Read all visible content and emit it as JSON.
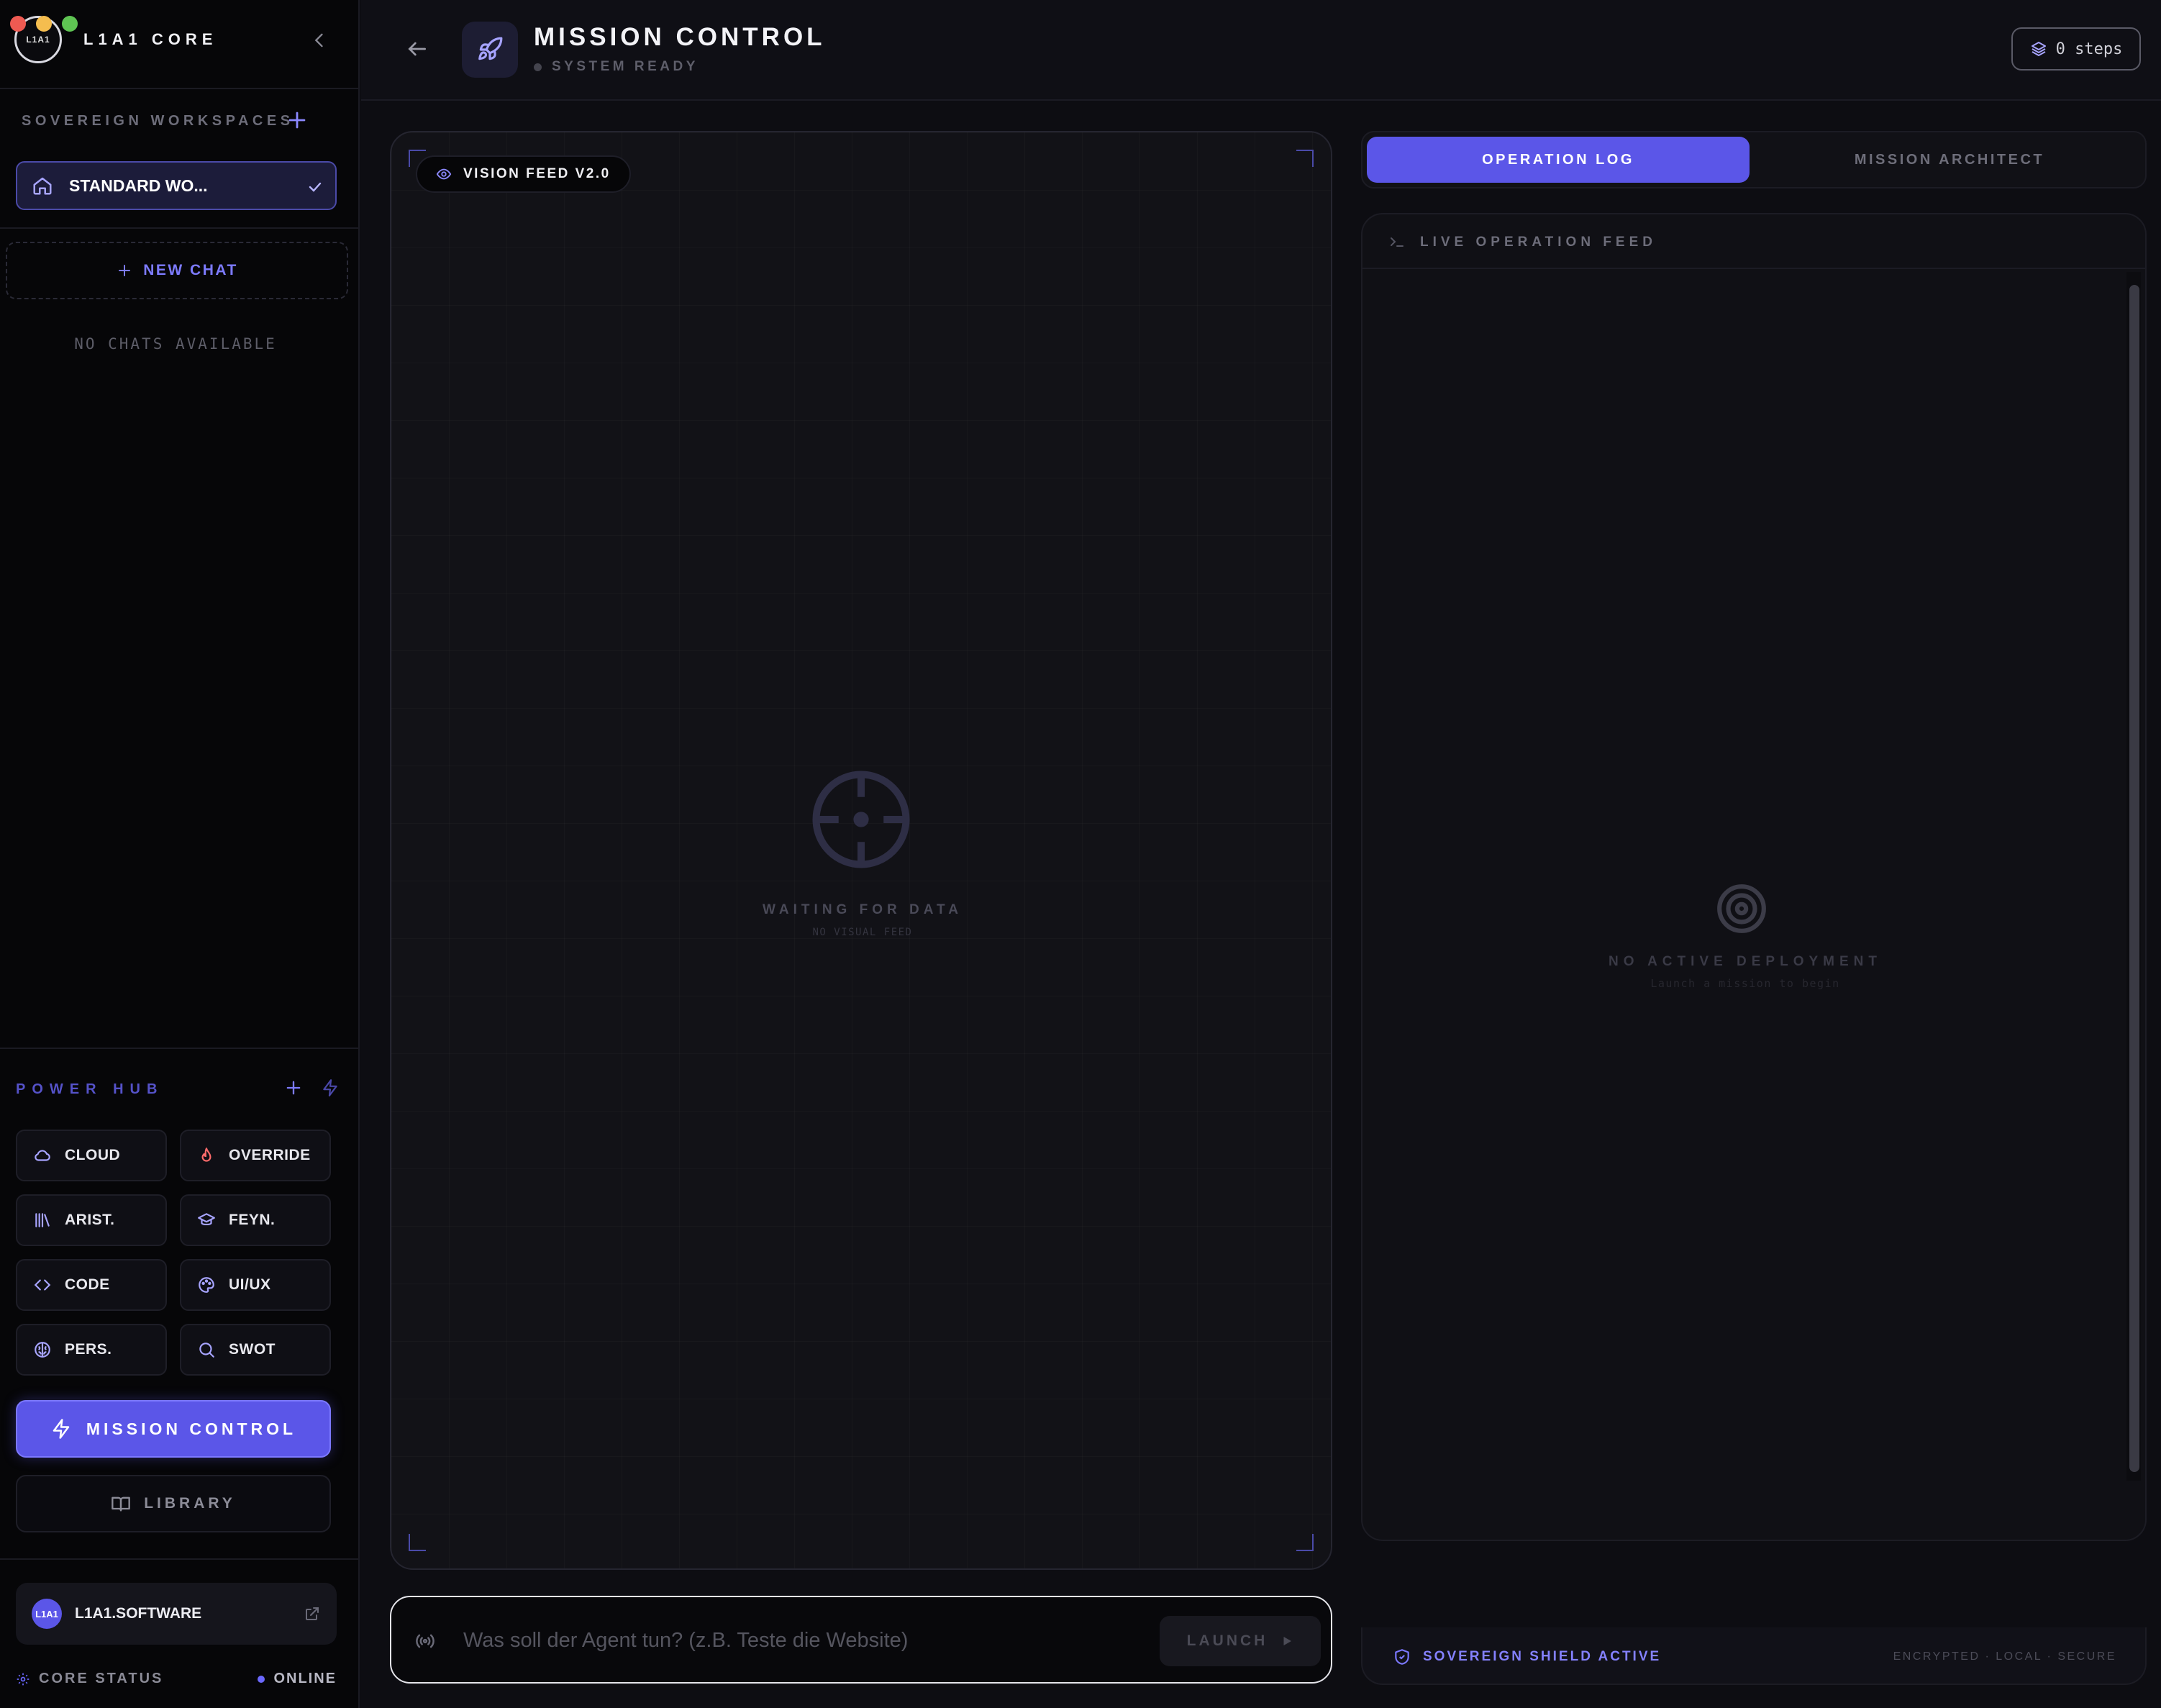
{
  "window": {
    "title": "L1A1 CORE"
  },
  "brand": {
    "logo_text": "L1A1",
    "name": "L1A1 CORE"
  },
  "workspaces": {
    "title": "SOVEREIGN WORKSPACES",
    "active": "STANDARD WO..."
  },
  "chats": {
    "new_label": "NEW CHAT",
    "empty_label": "NO CHATS AVAILABLE"
  },
  "power_hub": {
    "title": "POWER HUB",
    "items": [
      {
        "label": "CLOUD",
        "icon": "cloud-icon",
        "color": "#a7a4ff"
      },
      {
        "label": "OVERRIDE",
        "icon": "flame-icon",
        "color": "#ff6b6b"
      },
      {
        "label": "ARIST.",
        "icon": "library-icon",
        "color": "#a7a4ff"
      },
      {
        "label": "FEYN.",
        "icon": "graduation-cap-icon",
        "color": "#a7a4ff"
      },
      {
        "label": "CODE",
        "icon": "code-icon",
        "color": "#a7a4ff"
      },
      {
        "label": "UI/UX",
        "icon": "palette-icon",
        "color": "#a7a4ff"
      },
      {
        "label": "PERS.",
        "icon": "brain-icon",
        "color": "#a7a4ff"
      },
      {
        "label": "SWOT",
        "icon": "search-icon",
        "color": "#a7a4ff"
      }
    ],
    "mission_control": "MISSION CONTROL",
    "library": "LIBRARY"
  },
  "account": {
    "avatar_text": "L1A1",
    "name": "L1A1.SOFTWARE"
  },
  "status": {
    "label": "CORE STATUS",
    "value": "ONLINE"
  },
  "header": {
    "title": "MISSION CONTROL",
    "status": "SYSTEM READY",
    "steps": "0 steps"
  },
  "vision": {
    "badge": "VISION FEED V2.0",
    "waiting": "WAITING FOR DATA",
    "sub": "NO VISUAL FEED"
  },
  "command": {
    "placeholder": "Was soll der Agent tun? (z.B. Teste die Website)",
    "launch": "LAUNCH"
  },
  "tabs": {
    "active": "OPERATION LOG",
    "inactive": "MISSION ARCHITECT"
  },
  "feed": {
    "title": "LIVE OPERATION FEED",
    "empty_title": "NO ACTIVE DEPLOYMENT",
    "empty_sub": "Launch a mission to begin"
  },
  "shield": {
    "label": "SOVEREIGN SHIELD ACTIVE",
    "tags": "ENCRYPTED · LOCAL · SECURE"
  },
  "colors": {
    "accent": "#5b56e8",
    "accent_text": "#7d7bff",
    "background": "#0d0d12"
  }
}
